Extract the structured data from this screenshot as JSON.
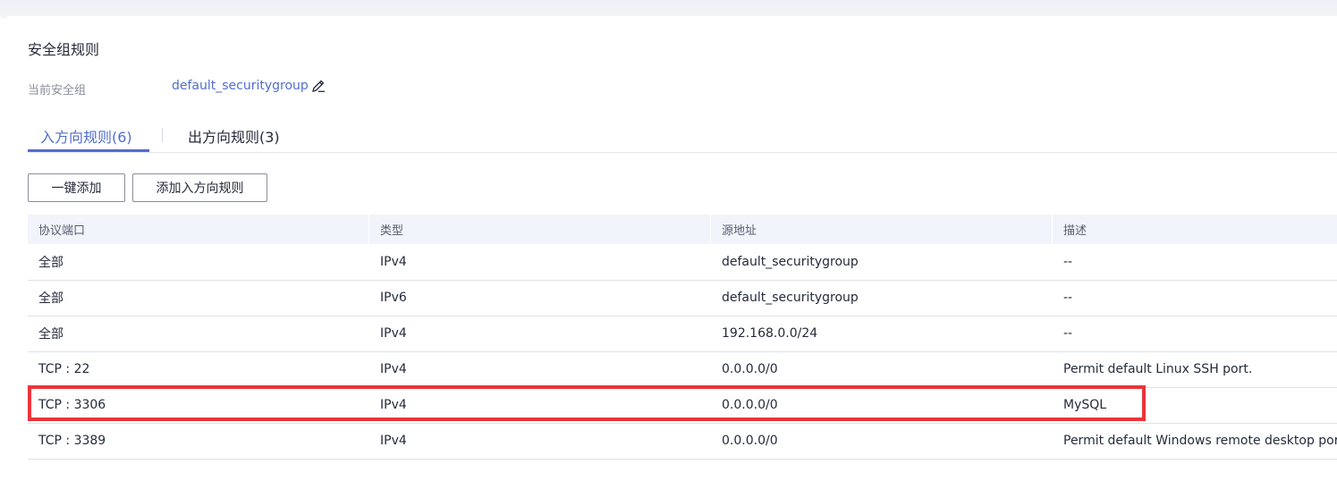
{
  "section": {
    "title": "安全组规则",
    "current_sg_label": "当前安全组",
    "current_sg_value": "default_securitygroup"
  },
  "tabs": [
    {
      "label": "入方向规则(6)",
      "active": true
    },
    {
      "label": "出方向规则(3)",
      "active": false
    }
  ],
  "buttons": {
    "quick_add": "一键添加",
    "add_inbound": "添加入方向规则"
  },
  "table": {
    "headers": [
      "协议端口",
      "类型",
      "源地址",
      "描述"
    ],
    "rows": [
      [
        "全部",
        "IPv4",
        "default_securitygroup",
        "--"
      ],
      [
        "全部",
        "IPv6",
        "default_securitygroup",
        "--"
      ],
      [
        "全部",
        "IPv4",
        "192.168.0.0/24",
        "--"
      ],
      [
        "TCP : 22",
        "IPv4",
        "0.0.0.0/0",
        "Permit default Linux SSH port."
      ],
      [
        "TCP : 3306",
        "IPv4",
        "0.0.0.0/0",
        "MySQL"
      ],
      [
        "TCP : 3389",
        "IPv4",
        "0.0.0.0/0",
        "Permit default Windows remote desktop port."
      ]
    ]
  },
  "colors": {
    "accent": "#526ecc",
    "highlight": "#e8353b",
    "header_bg": "#f2f4fb"
  },
  "icons": {
    "edit": "pencil-icon"
  }
}
